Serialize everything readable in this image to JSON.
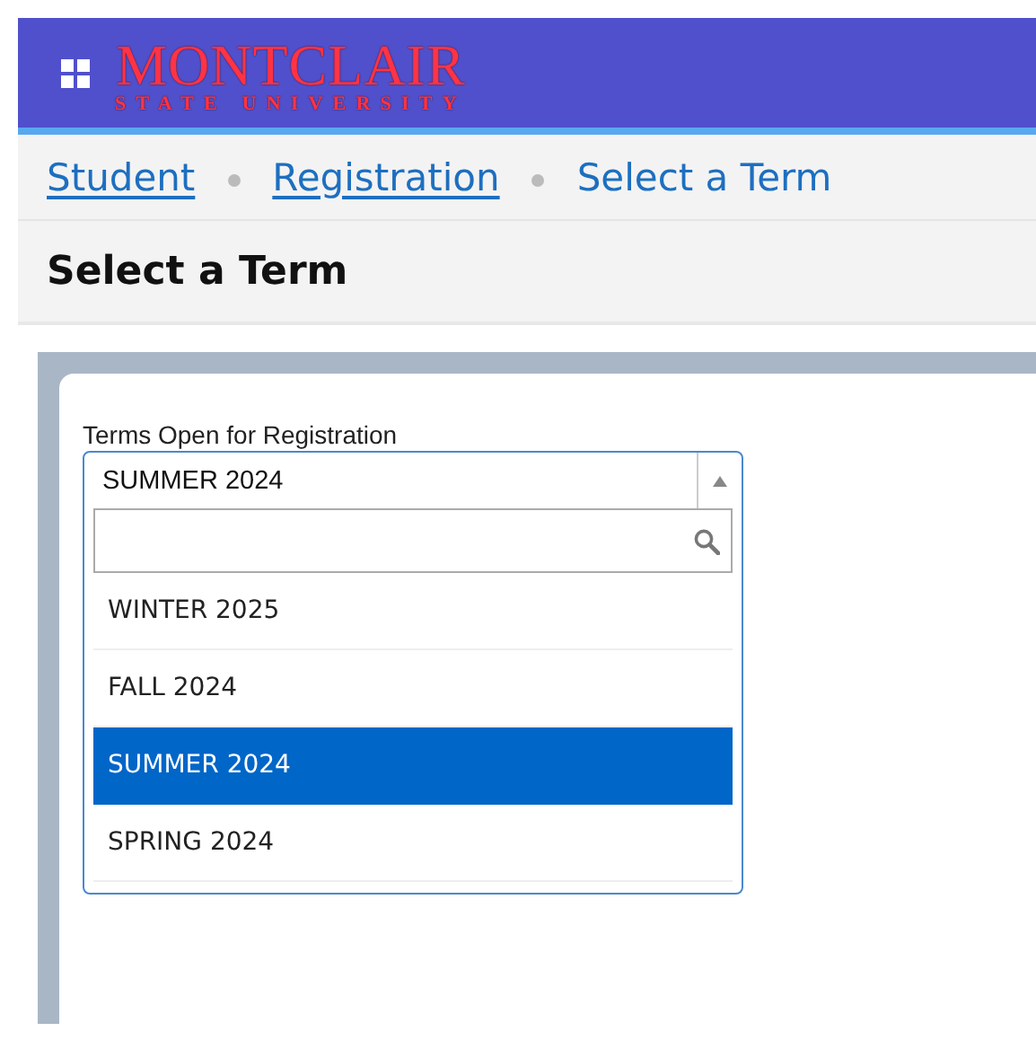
{
  "header": {
    "logo_title": "MONTCLAIR",
    "logo_subtitle": "STATE UNIVERSITY"
  },
  "breadcrumb": [
    {
      "label": "Student",
      "kind": "link"
    },
    {
      "label": "Registration",
      "kind": "link"
    },
    {
      "label": "Select a Term",
      "kind": "current"
    }
  ],
  "page_title": "Select a Term",
  "term_select": {
    "label": "Terms Open for Registration",
    "value": "SUMMER 2024",
    "expanded": true,
    "options": [
      {
        "label": "WINTER 2025",
        "selected": false
      },
      {
        "label": "FALL 2024",
        "selected": false
      },
      {
        "label": "SUMMER 2024",
        "selected": true
      },
      {
        "label": "SPRING 2024",
        "selected": false
      }
    ]
  }
}
